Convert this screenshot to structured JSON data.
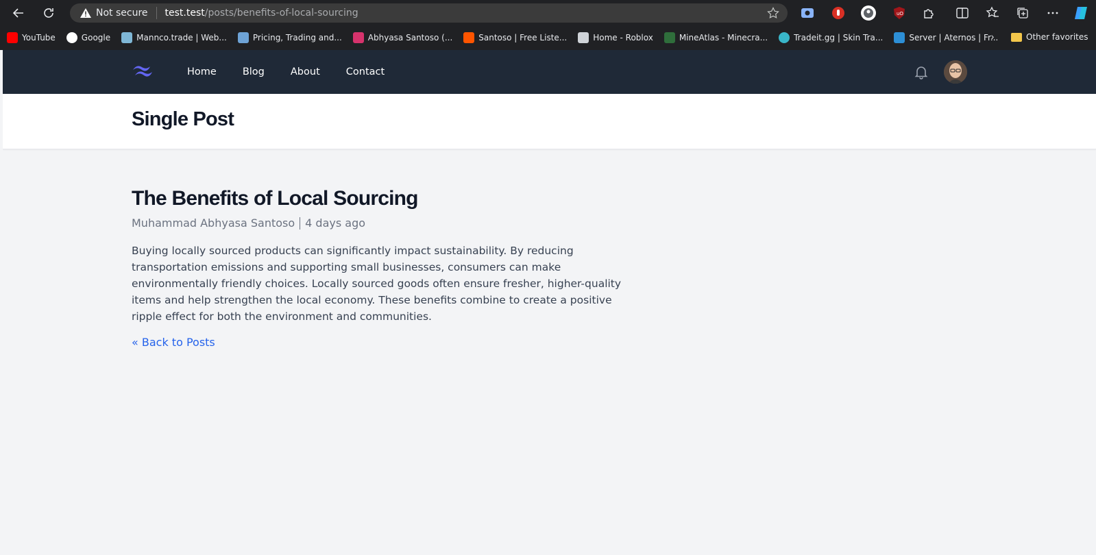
{
  "browser": {
    "security_label": "Not secure",
    "url_host": "test.test",
    "url_path": "/posts/benefits-of-local-sourcing",
    "bookmarks": [
      {
        "label": "YouTube",
        "icon": "youtube-icon",
        "color": "#ff0000"
      },
      {
        "label": "Google",
        "icon": "google-icon",
        "color": "#ffffff"
      },
      {
        "label": "Mannco.trade | Web...",
        "icon": "mannco-icon",
        "color": "#7fb7d6"
      },
      {
        "label": "Pricing, Trading and...",
        "icon": "tf-icon",
        "color": "#6ea3d6"
      },
      {
        "label": "Abhyasa Santoso (...",
        "icon": "instagram-icon",
        "color": "#d6336c"
      },
      {
        "label": "Santoso | Free Liste...",
        "icon": "soundcloud-icon",
        "color": "#ff5500"
      },
      {
        "label": "Home - Roblox",
        "icon": "roblox-icon",
        "color": "#cfd3d8"
      },
      {
        "label": "MineAtlas - Minecra...",
        "icon": "mineatlas-icon",
        "color": "#2f6e3b"
      },
      {
        "label": "Tradeit.gg | Skin Tra...",
        "icon": "tradeit-icon",
        "color": "#39b6c9"
      },
      {
        "label": "Server | Aternos | Fr...",
        "icon": "aternos-icon",
        "color": "#2d8fd6"
      }
    ],
    "other_favorites": "Other favorites"
  },
  "nav": {
    "links": [
      "Home",
      "Blog",
      "About",
      "Contact"
    ]
  },
  "header": {
    "title": "Single Post"
  },
  "post": {
    "title": "The Benefits of Local Sourcing",
    "author": "Muhammad Abhyasa Santoso",
    "time": "4 days ago",
    "body": "Buying locally sourced products can significantly impact sustainability. By reducing transportation emissions and supporting small businesses, consumers can make environmentally friendly choices. Locally sourced goods often ensure fresher, higher-quality items and help strengthen the local economy. These benefits combine to create a positive ripple effect for both the environment and communities.",
    "back_link": "« Back to Posts"
  },
  "colors": {
    "nav_bg": "#1f2937",
    "page_bg": "#f3f4f6",
    "link": "#2563eb",
    "logo": "#6366f1"
  }
}
